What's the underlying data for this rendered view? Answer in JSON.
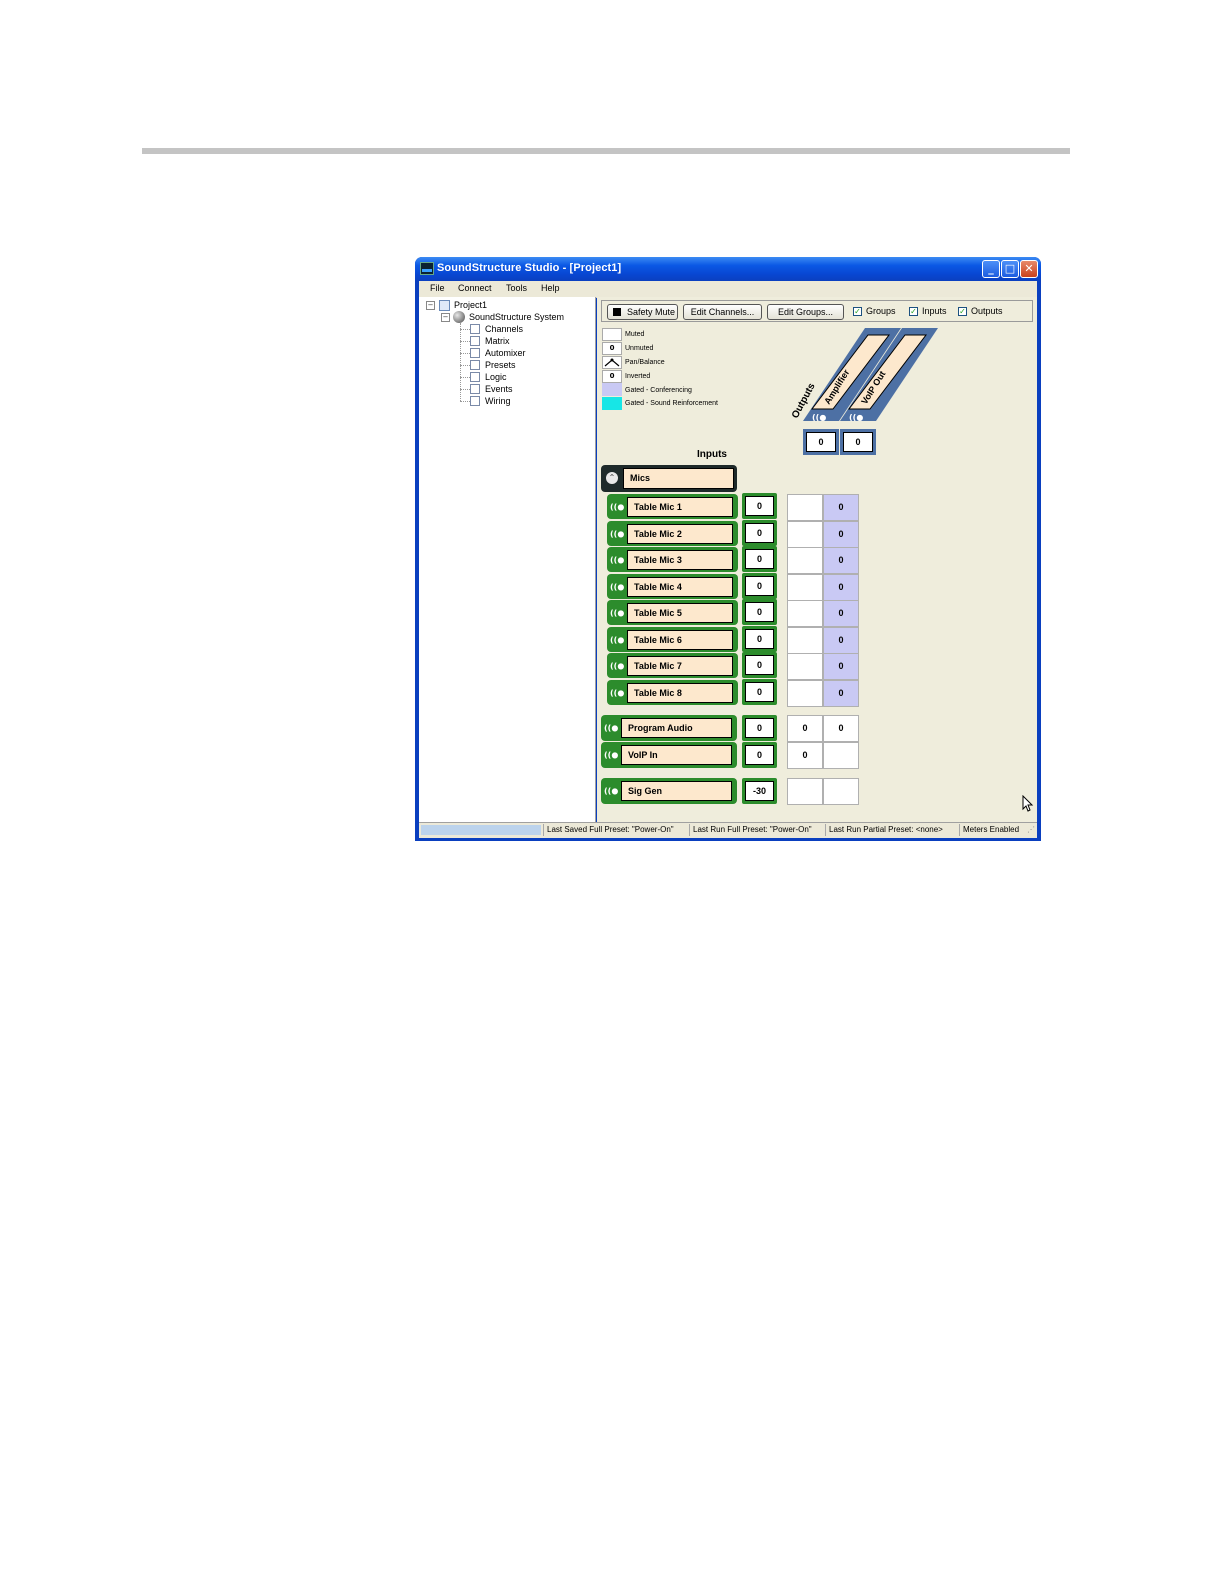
{
  "window": {
    "title": "SoundStructure Studio - [Project1]"
  },
  "menu": [
    "File",
    "Connect",
    "Tools",
    "Help"
  ],
  "tree": {
    "root": "Project1",
    "system": "SoundStructure System",
    "children": [
      "Channels",
      "Matrix",
      "Automixer",
      "Presets",
      "Logic",
      "Events",
      "Wiring"
    ]
  },
  "toolbar": {
    "safety_mute": "Safety Mute",
    "edit_channels": "Edit Channels...",
    "edit_groups": "Edit Groups...",
    "groups": "Groups",
    "inputs": "Inputs",
    "outputs": "Outputs"
  },
  "legend": [
    {
      "swatch": "",
      "label": "Muted"
    },
    {
      "swatch": "0",
      "label": "Unmuted"
    },
    {
      "swatch": "",
      "label": "Pan/Balance"
    },
    {
      "swatch": "0",
      "label": "Inverted"
    },
    {
      "swatch": "",
      "label": "Gated - Conferencing"
    },
    {
      "swatch": "",
      "label": "Gated - Sound Reinforcement"
    }
  ],
  "colors": {
    "gated_conferencing": "#c9c9f4",
    "gated_sound_reinforcement": "#17e6e6",
    "input_green": "#2c8c2c",
    "output_blue": "#4d70a4",
    "label_fill": "#fde8cd"
  },
  "outputs": {
    "heading": "Outputs",
    "channels": [
      {
        "name": "Amplifier",
        "gain": "0"
      },
      {
        "name": "VoIP Out",
        "gain": "0"
      }
    ]
  },
  "inputs": {
    "heading": "Inputs",
    "group": "Mics",
    "mics": [
      {
        "name": "Table Mic 1",
        "gain": "0",
        "amp": "",
        "voip": "0"
      },
      {
        "name": "Table Mic 2",
        "gain": "0",
        "amp": "",
        "voip": "0"
      },
      {
        "name": "Table Mic 3",
        "gain": "0",
        "amp": "",
        "voip": "0"
      },
      {
        "name": "Table Mic 4",
        "gain": "0",
        "amp": "",
        "voip": "0"
      },
      {
        "name": "Table Mic 5",
        "gain": "0",
        "amp": "",
        "voip": "0"
      },
      {
        "name": "Table Mic 6",
        "gain": "0",
        "amp": "",
        "voip": "0"
      },
      {
        "name": "Table Mic 7",
        "gain": "0",
        "amp": "",
        "voip": "0"
      },
      {
        "name": "Table Mic 8",
        "gain": "0",
        "amp": "",
        "voip": "0"
      }
    ],
    "program_audio": {
      "name": "Program Audio",
      "gain": "0",
      "amp": "0",
      "voip": "0"
    },
    "voip_in": {
      "name": "VoIP In",
      "gain": "0",
      "amp": "0",
      "voip": ""
    },
    "sig_gen": {
      "name": "Sig Gen",
      "gain": "-30",
      "amp": "",
      "voip": ""
    }
  },
  "status": {
    "last_saved": "Last Saved Full Preset: \"Power-On\"",
    "last_run": "Last Run Full Preset: \"Power-On\"",
    "last_partial": "Last Run Partial Preset: <none>",
    "meters": "Meters Enabled"
  }
}
